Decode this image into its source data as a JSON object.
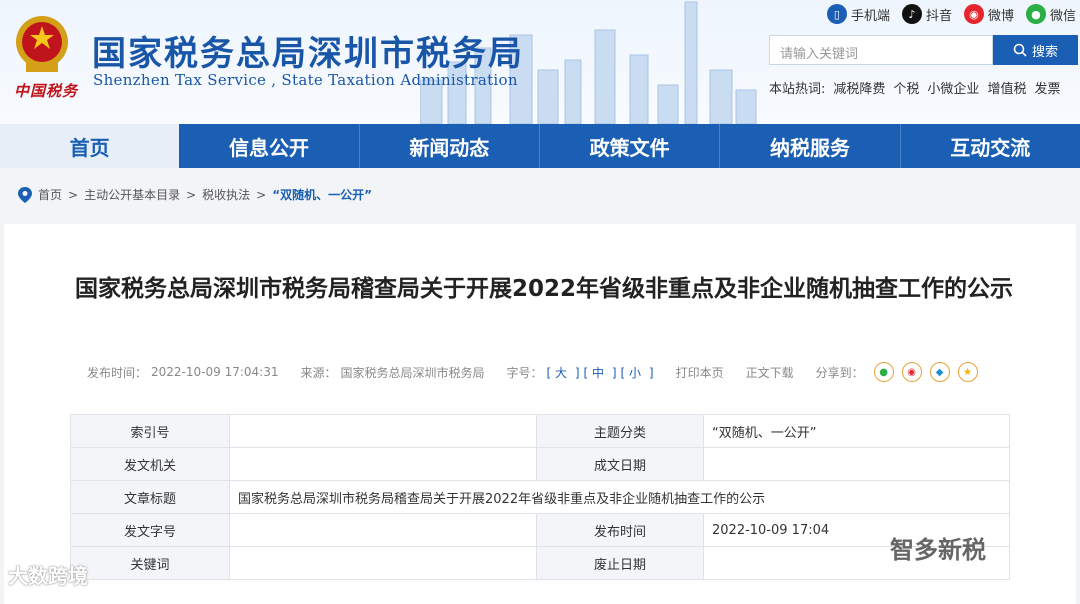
{
  "header": {
    "title": "国家税务总局深圳市税务局",
    "subtitle": "Shenzhen Tax Service , State Taxation Administration",
    "logo_text": "中国税务",
    "top_links": [
      {
        "label": "手机端",
        "icon": "mobile-icon",
        "color": "#1a5fb4"
      },
      {
        "label": "抖音",
        "icon": "douyin-icon",
        "color": "#111111"
      },
      {
        "label": "微博",
        "icon": "weibo-icon",
        "color": "#e6262e"
      },
      {
        "label": "微信",
        "icon": "wechat-icon",
        "color": "#2aae45"
      }
    ],
    "search": {
      "placeholder": "请输入关键词",
      "button": "搜索"
    },
    "hot": {
      "label": "本站热词:",
      "items": [
        "减税降费",
        "个税",
        "小微企业",
        "增值税",
        "发票"
      ]
    }
  },
  "nav": [
    "首页",
    "信息公开",
    "新闻动态",
    "政策文件",
    "纳税服务",
    "互动交流"
  ],
  "breadcrumb": {
    "items": [
      "首页",
      "主动公开基本目录",
      "税收执法"
    ],
    "current": "“双随机、一公开”",
    "sep": ">"
  },
  "article": {
    "title": "国家税务总局深圳市税务局稽查局关于开展2022年省级非重点及非企业随机抽查工作的公示",
    "publish_label": "发布时间：",
    "publish_time": "2022-10-09 17:04:31",
    "source_label": "来源：",
    "source": "国家税务总局深圳市税务局",
    "fontsize_label": "字号：",
    "font_large": "大",
    "font_medium": "中",
    "font_small": "小",
    "print": "打印本页",
    "download": "正文下载",
    "share_label": "分享到："
  },
  "info_table": [
    [
      "索引号",
      "",
      "主题分类",
      "“双随机、一公开”"
    ],
    [
      "发文机关",
      "",
      "成文日期",
      ""
    ],
    [
      "文章标题",
      "国家税务总局深圳市税务局稽查局关于开展2022年省级非重点及非企业随机抽查工作的公示"
    ],
    [
      "发文字号",
      "",
      "发布时间",
      "2022-10-09 17:04"
    ],
    [
      "关键词",
      "",
      "废止日期",
      ""
    ]
  ],
  "watermarks": {
    "left": "大数跨境",
    "right": "智多新税"
  },
  "colors": {
    "brand": "#1a5fb4",
    "emblem_red": "#c0141c"
  }
}
